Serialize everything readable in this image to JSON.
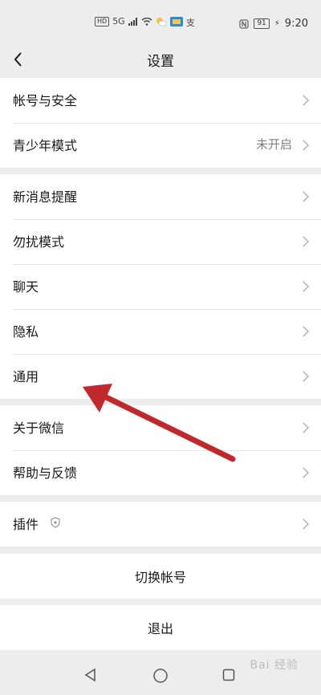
{
  "status_bar": {
    "hd": "HD",
    "signal": "5G",
    "battery": "91",
    "time": "9:20"
  },
  "nav": {
    "title": "设置"
  },
  "groups": [
    {
      "items": [
        {
          "label": "帐号与安全"
        },
        {
          "label": "青少年模式",
          "value": "未开启"
        }
      ]
    },
    {
      "items": [
        {
          "label": "新消息提醒"
        },
        {
          "label": "勿扰模式"
        },
        {
          "label": "聊天"
        },
        {
          "label": "隐私"
        },
        {
          "label": "通用"
        }
      ]
    },
    {
      "items": [
        {
          "label": "关于微信"
        },
        {
          "label": "帮助与反馈"
        }
      ]
    },
    {
      "items": [
        {
          "label": "插件"
        }
      ]
    }
  ],
  "actions": {
    "switch_account": "切换帐号",
    "logout": "退出"
  },
  "watermark": {
    "text": "Bai 经验"
  },
  "colors": {
    "background": "#ededed",
    "arrow": "#c0282b",
    "secondary_text": "#808080"
  }
}
